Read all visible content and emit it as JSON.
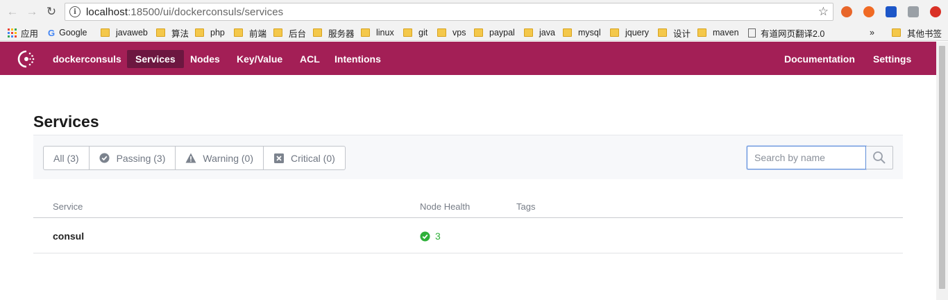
{
  "browser": {
    "url_host": "localhost",
    "url_rest": ":18500/ui/dockerconsuls/services",
    "bookmarks": [
      "应用",
      "Google",
      "javaweb",
      "算法",
      "php",
      "前端",
      "后台",
      "服务器",
      "linux",
      "git",
      "vps",
      "paypal",
      "java",
      "mysql",
      "jquery",
      "设计",
      "maven",
      "有道网页翻译2.0"
    ],
    "overflow": "»",
    "other_bookmarks": "其他书签"
  },
  "header": {
    "brand": "dockerconsuls",
    "nav": [
      "Services",
      "Nodes",
      "Key/Value",
      "ACL",
      "Intentions"
    ],
    "right": [
      "Documentation",
      "Settings"
    ],
    "active": "Services",
    "color": "#a31f56"
  },
  "page": {
    "title": "Services",
    "filters": [
      "All (3)",
      "Passing (3)",
      "Warning (0)",
      "Critical (0)"
    ],
    "search_placeholder": "Search by name"
  },
  "table": {
    "columns": [
      "Service",
      "Node Health",
      "Tags"
    ],
    "rows": [
      {
        "service": "consul",
        "node_health": "3",
        "tags": ""
      }
    ]
  }
}
